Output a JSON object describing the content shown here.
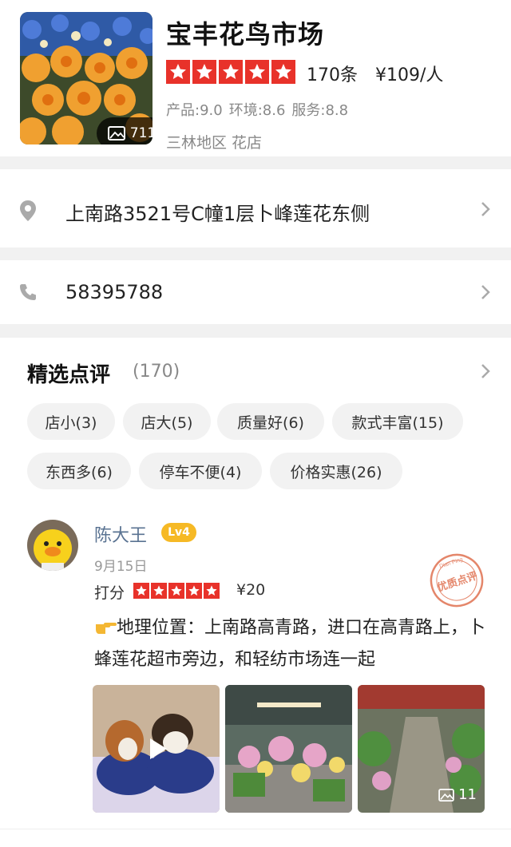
{
  "shop": {
    "name": "宝丰花鸟市场",
    "review_count": "170条",
    "avg_price": "¥109/人",
    "rating_stars": 5,
    "scores": {
      "product": "产品:9.0",
      "environment": "环境:8.6",
      "service": "服务:8.8"
    },
    "area": "三林地区",
    "category": "花店",
    "photo_count": "711"
  },
  "address": {
    "text": "上南路3521号C幢1层卜峰莲花东侧",
    "icon": "location-pin-icon"
  },
  "phone": {
    "text": "58395788",
    "icon": "phone-icon"
  },
  "reviews": {
    "title": "精选点评",
    "count": "(170)",
    "tags": [
      "店小(3)",
      "店大(5)",
      "质量好(6)",
      "款式丰富(15)",
      "东西多(6)",
      "停车不便(4)",
      "价格实惠(26)"
    ],
    "featured": {
      "user": "陈大王",
      "level": "Lv4",
      "date": "9月15日",
      "score_label": "打分",
      "stars": 5,
      "price": "¥20",
      "stamp_text": "优质点评",
      "stamp_top": "Dian Ping",
      "content": "地理位置：上南路高青路，进口在高青路上，卜蜂莲花超市旁边，和轻纺市场连一起",
      "more_photos": "11"
    }
  },
  "colors": {
    "star_red": "#e8322a",
    "badge_yellow": "#f6b925",
    "username_blue": "#5a7392",
    "stamp_red": "#d9532c"
  }
}
